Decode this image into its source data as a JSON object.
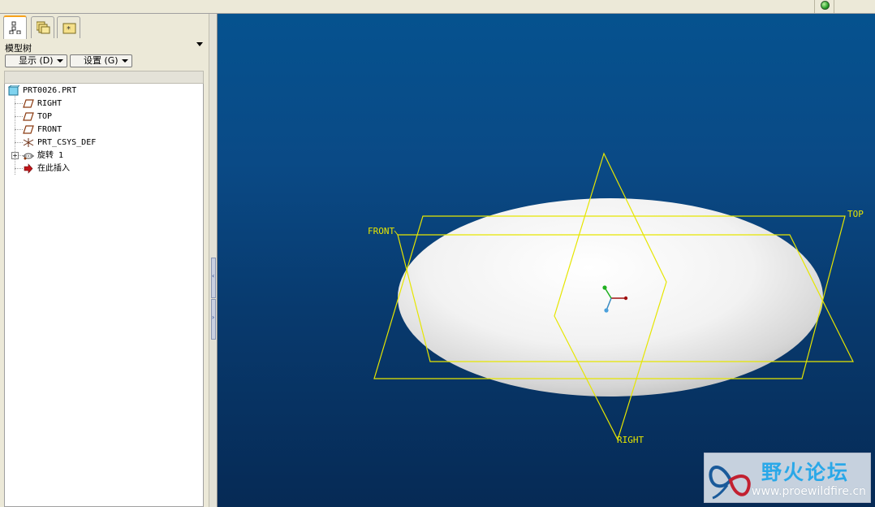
{
  "app": {
    "status_color": "#22a022"
  },
  "panel": {
    "tabs": [
      {
        "name": "model-tree-tab",
        "icon": "tree-icon",
        "active": true
      },
      {
        "name": "folder-browser-tab",
        "icon": "folders-icon",
        "active": false
      },
      {
        "name": "favorites-tab",
        "icon": "favorites-icon",
        "active": false
      }
    ],
    "title": "模型树",
    "show_button": "显示 (D)",
    "settings_button": "设置 (G)"
  },
  "tree": {
    "root": {
      "label": "PRT0026.PRT",
      "icon": "part-icon"
    },
    "items": [
      {
        "label": "RIGHT",
        "icon": "datum-plane-icon"
      },
      {
        "label": "TOP",
        "icon": "datum-plane-icon"
      },
      {
        "label": "FRONT",
        "icon": "datum-plane-icon"
      },
      {
        "label": "PRT_CSYS_DEF",
        "icon": "coordinate-system-icon"
      },
      {
        "label": "旋转 1",
        "icon": "revolve-icon",
        "expandable": true
      },
      {
        "label": "在此插入",
        "icon": "insert-here-arrow-icon"
      }
    ]
  },
  "viewport": {
    "background_top": "#05528f",
    "background_bottom": "#062a55",
    "plane_color": "#e6e600",
    "plane_labels": {
      "front": "FRONT",
      "top": "TOP",
      "right": "RIGHT"
    }
  },
  "watermark": {
    "title": "野火论坛",
    "url": "www.proewildfire.cn"
  }
}
